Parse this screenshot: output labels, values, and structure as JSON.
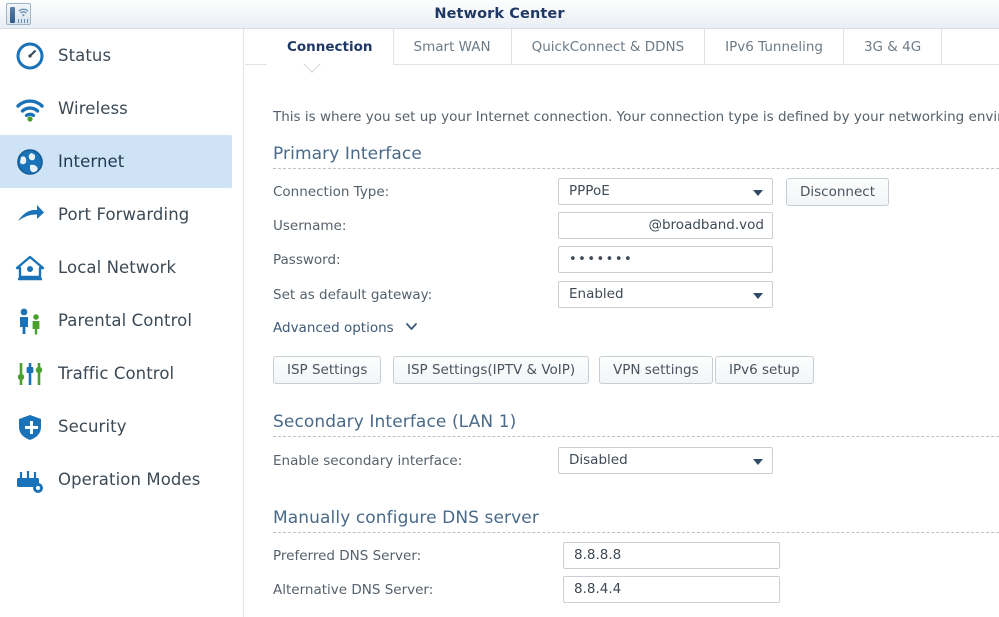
{
  "window": {
    "title": "Network Center",
    "logo_icon": "router-icon"
  },
  "sidebar": {
    "items": [
      {
        "label": "Status",
        "icon": "gauge-icon",
        "selected": false
      },
      {
        "label": "Wireless",
        "icon": "wifi-icon",
        "selected": false
      },
      {
        "label": "Internet",
        "icon": "globe-icon",
        "selected": true
      },
      {
        "label": "Port Forwarding",
        "icon": "arrow-forward-icon",
        "selected": false
      },
      {
        "label": "Local Network",
        "icon": "house-icon",
        "selected": false
      },
      {
        "label": "Parental Control",
        "icon": "family-icon",
        "selected": false
      },
      {
        "label": "Traffic Control",
        "icon": "sliders-icon",
        "selected": false
      },
      {
        "label": "Security",
        "icon": "shield-icon",
        "selected": false
      },
      {
        "label": "Operation Modes",
        "icon": "router-gear-icon",
        "selected": false
      }
    ]
  },
  "tabs": [
    {
      "label": "Connection",
      "active": true
    },
    {
      "label": "Smart WAN",
      "active": false
    },
    {
      "label": "QuickConnect & DDNS",
      "active": false
    },
    {
      "label": "IPv6 Tunneling",
      "active": false
    },
    {
      "label": "3G & 4G",
      "active": false
    }
  ],
  "main": {
    "intro": "This is where you set up your Internet connection. Your connection type is defined by your networking environm",
    "primary_interface": {
      "title": "Primary Interface",
      "connection_type_label": "Connection Type:",
      "connection_type_value": "PPPoE",
      "disconnect_label": "Disconnect",
      "username_label": "Username:",
      "username_value": "@broadband.vod",
      "password_label": "Password:",
      "password_value": "•••••••",
      "gateway_label": "Set as default gateway:",
      "gateway_value": "Enabled",
      "advanced_options_label": "Advanced options",
      "buttons": [
        {
          "label": "ISP Settings"
        },
        {
          "label": "ISP Settings(IPTV & VoIP)"
        },
        {
          "label": "VPN settings"
        },
        {
          "label": "IPv6 setup"
        }
      ]
    },
    "secondary_interface": {
      "title": "Secondary Interface (LAN 1)",
      "enable_label": "Enable secondary interface:",
      "enable_value": "Disabled"
    },
    "dns": {
      "title": "Manually configure DNS server",
      "preferred_label": "Preferred DNS Server:",
      "preferred_value": "8.8.8.8",
      "alternative_label": "Alternative DNS Server:",
      "alternative_value": "8.8.4.4"
    }
  },
  "colors": {
    "accent": "#1f3864",
    "selected_row": "#cfe3f6",
    "section_heading": "#4a6a8a",
    "icon_blue": "#1a73b8",
    "icon_green": "#4aa02c"
  }
}
